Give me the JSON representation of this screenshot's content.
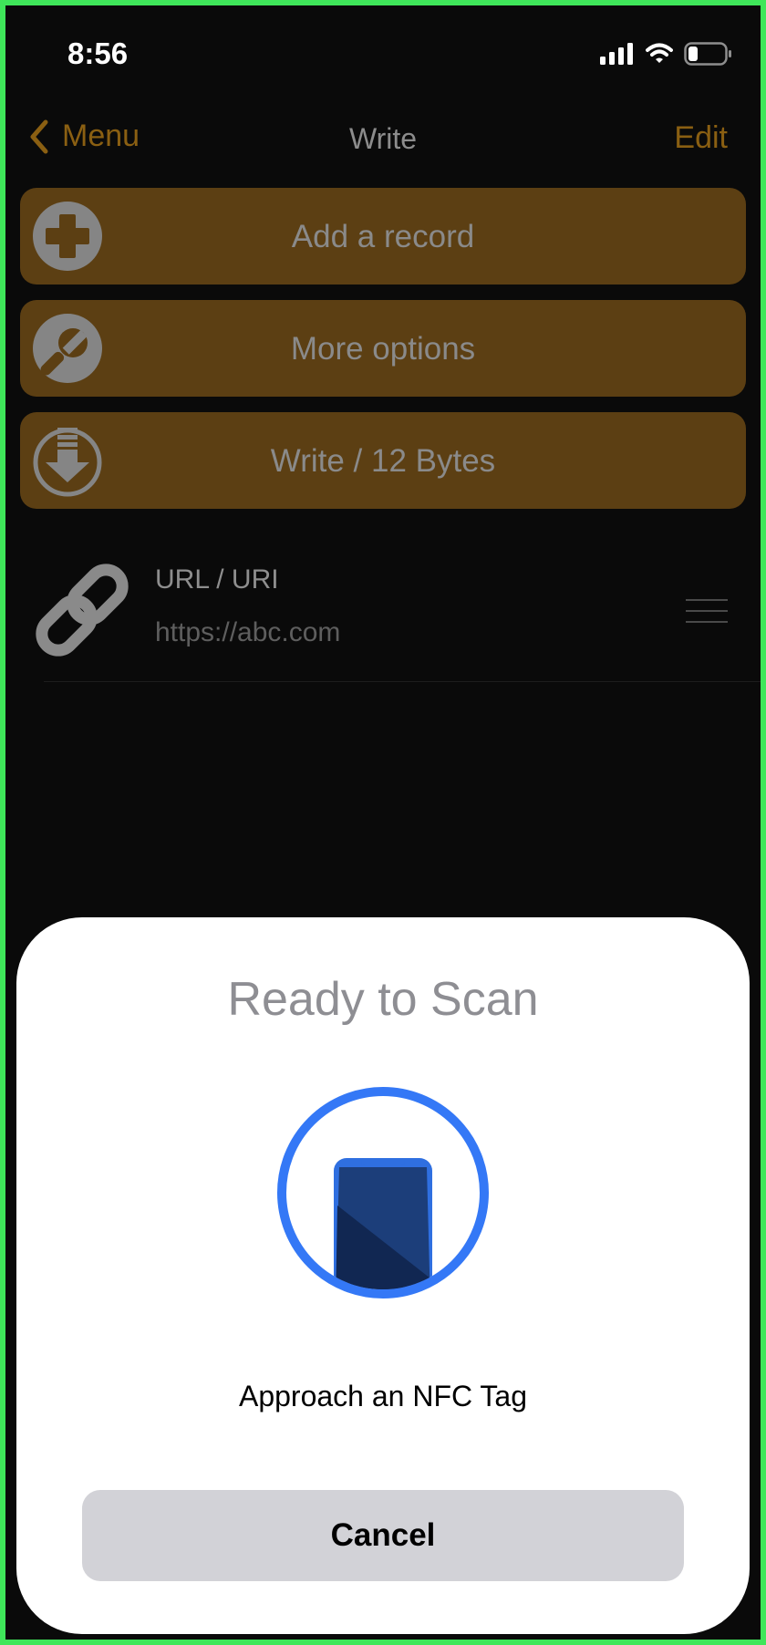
{
  "status_bar": {
    "time": "8:56",
    "icons": [
      "cellular-signal-icon",
      "wifi-icon",
      "battery-icon"
    ]
  },
  "nav": {
    "back_label": "Menu",
    "title": "Write",
    "edit_label": "Edit"
  },
  "actions": [
    {
      "label": "Add a record",
      "icon": "plus-circle-icon"
    },
    {
      "label": "More options",
      "icon": "wrench-icon"
    },
    {
      "label": "Write / 12 Bytes",
      "icon": "download-arrow-icon"
    }
  ],
  "record": {
    "type": "URL / URI",
    "value": "https://abc.com",
    "icon": "link-icon"
  },
  "sheet": {
    "title": "Ready to Scan",
    "message": "Approach an NFC Tag",
    "cancel_label": "Cancel",
    "icon": "nfc-phone-icon"
  },
  "colors": {
    "frame_border": "#3fe65a",
    "accent": "#8a5f12",
    "button_bg": "#5c3f13",
    "nfc_ring": "#3478f6",
    "cancel_bg": "#d2d2d7"
  }
}
